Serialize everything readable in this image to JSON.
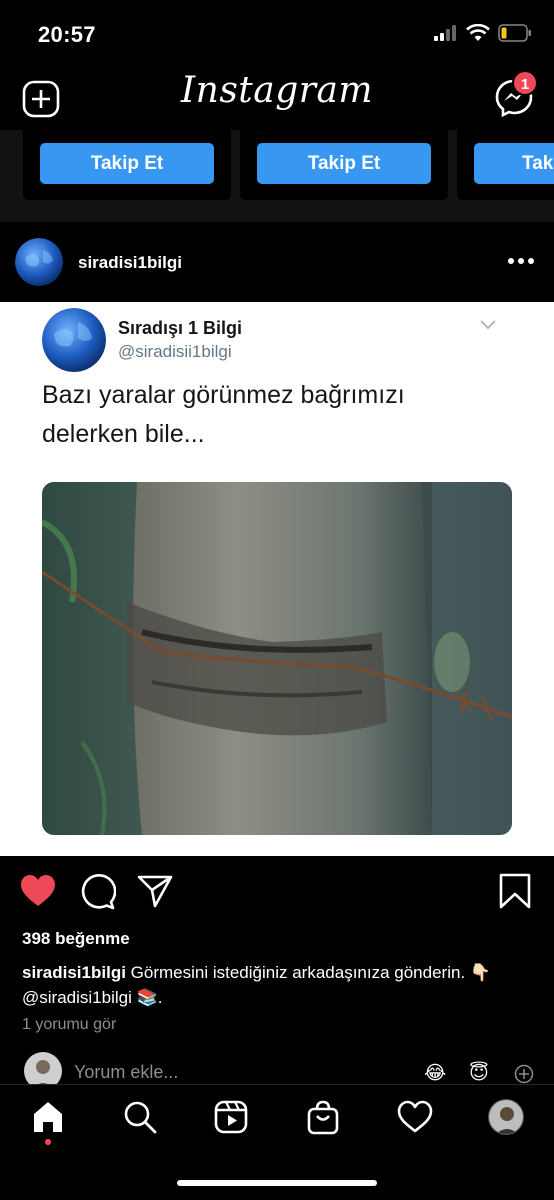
{
  "status_bar": {
    "time": "20:57"
  },
  "header": {
    "logo": "Instagram",
    "dm_badge_count": "1"
  },
  "suggestions": {
    "follow_label": "Takip Et",
    "follow_label_partial": "Tak"
  },
  "post": {
    "username": "siradisi1bilgi",
    "tweet": {
      "display_name": "Sıradışı 1 Bilgi",
      "handle": "@siradisii1bilgi",
      "text": "Bazı yaralar görünmez bağrımızı delerken bile..."
    },
    "likes": "398 beğenme",
    "caption_user": "siradisi1bilgi",
    "caption_text": " Görmesini istediğiniz arkadaşınıza gönderin. 👇🏻 @siradisi1bilgi 📚.",
    "view_comments": "1 yorumu gör",
    "comment_placeholder": "Yorum ekle...",
    "emojis": [
      "😂",
      "😇"
    ],
    "liked": true
  },
  "colors": {
    "accent": "#3897f0",
    "like": "#ed4956",
    "background": "#000000"
  }
}
